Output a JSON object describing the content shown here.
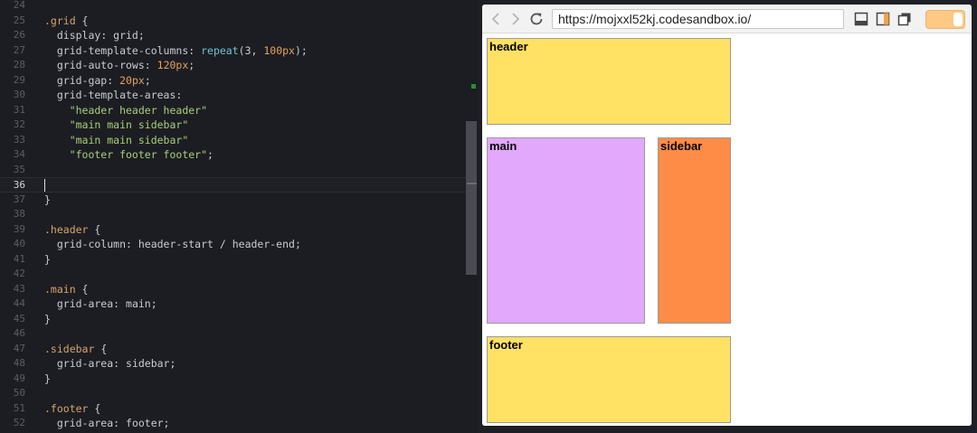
{
  "editor": {
    "lines": [
      {
        "n": "24",
        "tokens": []
      },
      {
        "n": "25",
        "tokens": [
          {
            "t": ".grid",
            "c": "c-sel"
          },
          {
            "t": " {",
            "c": "c-punc"
          }
        ]
      },
      {
        "n": "26",
        "tokens": [
          {
            "t": "  display",
            "c": "c-prop"
          },
          {
            "t": ": grid;",
            "c": "c-punc"
          }
        ]
      },
      {
        "n": "27",
        "tokens": [
          {
            "t": "  grid-template-columns",
            "c": "c-prop"
          },
          {
            "t": ": ",
            "c": "c-punc"
          },
          {
            "t": "repeat",
            "c": "c-fn"
          },
          {
            "t": "(3, ",
            "c": "c-punc"
          },
          {
            "t": "100px",
            "c": "c-num"
          },
          {
            "t": ");",
            "c": "c-punc"
          }
        ]
      },
      {
        "n": "28",
        "tokens": [
          {
            "t": "  grid-auto-rows",
            "c": "c-prop"
          },
          {
            "t": ": ",
            "c": "c-punc"
          },
          {
            "t": "120px",
            "c": "c-num"
          },
          {
            "t": ";",
            "c": "c-punc"
          }
        ]
      },
      {
        "n": "29",
        "tokens": [
          {
            "t": "  grid-gap",
            "c": "c-prop"
          },
          {
            "t": ": ",
            "c": "c-punc"
          },
          {
            "t": "20px",
            "c": "c-num"
          },
          {
            "t": ";",
            "c": "c-punc"
          }
        ]
      },
      {
        "n": "30",
        "tokens": [
          {
            "t": "  grid-template-areas",
            "c": "c-prop"
          },
          {
            "t": ":",
            "c": "c-punc"
          }
        ]
      },
      {
        "n": "31",
        "tokens": [
          {
            "t": "    \"header header header\"",
            "c": "c-str"
          }
        ]
      },
      {
        "n": "32",
        "tokens": [
          {
            "t": "    \"main main sidebar\"",
            "c": "c-str"
          }
        ]
      },
      {
        "n": "33",
        "tokens": [
          {
            "t": "    \"main main sidebar\"",
            "c": "c-str"
          }
        ]
      },
      {
        "n": "34",
        "tokens": [
          {
            "t": "    \"footer footer footer\"",
            "c": "c-str"
          },
          {
            "t": ";",
            "c": "c-punc"
          }
        ]
      },
      {
        "n": "35",
        "tokens": []
      },
      {
        "n": "36",
        "tokens": [],
        "active": true
      },
      {
        "n": "37",
        "tokens": [
          {
            "t": "}",
            "c": "c-punc"
          }
        ]
      },
      {
        "n": "38",
        "tokens": []
      },
      {
        "n": "39",
        "tokens": [
          {
            "t": ".header",
            "c": "c-sel"
          },
          {
            "t": " {",
            "c": "c-punc"
          }
        ]
      },
      {
        "n": "40",
        "tokens": [
          {
            "t": "  grid-column",
            "c": "c-prop"
          },
          {
            "t": ": header-start / header-end;",
            "c": "c-punc"
          }
        ]
      },
      {
        "n": "41",
        "tokens": [
          {
            "t": "}",
            "c": "c-punc"
          }
        ]
      },
      {
        "n": "42",
        "tokens": []
      },
      {
        "n": "43",
        "tokens": [
          {
            "t": ".main",
            "c": "c-sel"
          },
          {
            "t": " {",
            "c": "c-punc"
          }
        ]
      },
      {
        "n": "44",
        "tokens": [
          {
            "t": "  grid-area",
            "c": "c-prop"
          },
          {
            "t": ": main;",
            "c": "c-punc"
          }
        ]
      },
      {
        "n": "45",
        "tokens": [
          {
            "t": "}",
            "c": "c-punc"
          }
        ]
      },
      {
        "n": "46",
        "tokens": []
      },
      {
        "n": "47",
        "tokens": [
          {
            "t": ".sidebar",
            "c": "c-sel"
          },
          {
            "t": " {",
            "c": "c-punc"
          }
        ]
      },
      {
        "n": "48",
        "tokens": [
          {
            "t": "  grid-area",
            "c": "c-prop"
          },
          {
            "t": ": sidebar;",
            "c": "c-punc"
          }
        ]
      },
      {
        "n": "49",
        "tokens": [
          {
            "t": "}",
            "c": "c-punc"
          }
        ]
      },
      {
        "n": "50",
        "tokens": []
      },
      {
        "n": "51",
        "tokens": [
          {
            "t": ".footer",
            "c": "c-sel"
          },
          {
            "t": " {",
            "c": "c-punc"
          }
        ]
      },
      {
        "n": "52",
        "tokens": [
          {
            "t": "  grid-area",
            "c": "c-prop"
          },
          {
            "t": ": footer;",
            "c": "c-punc"
          }
        ]
      }
    ]
  },
  "browser": {
    "back_icon": "chevron-left-icon",
    "forward_icon": "chevron-right-icon",
    "reload_icon": "reload-icon",
    "url": "https://mojxxl52kj.codesandbox.io/",
    "toolbar_icons": [
      "dock-bottom-icon",
      "dock-right-icon",
      "new-window-icon"
    ],
    "toggle_color": "#ffc983"
  },
  "preview": {
    "header_label": "header",
    "main_label": "main",
    "sidebar_label": "sidebar",
    "footer_label": "footer",
    "colors": {
      "header": "#ffe164",
      "main": "#e2a8fb",
      "sidebar": "#fe8c47",
      "footer": "#ffe164"
    }
  }
}
